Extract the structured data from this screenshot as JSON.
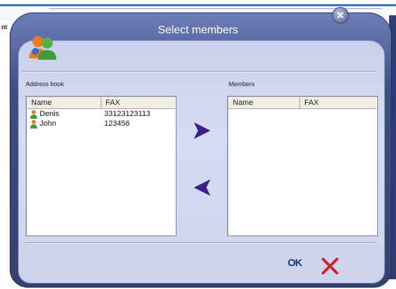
{
  "background": {
    "label": "nt"
  },
  "dialog": {
    "title": "Select members",
    "close_symbol": "✕",
    "address_book": {
      "label": "Address book",
      "columns": [
        "Name",
        "FAX"
      ],
      "rows": [
        {
          "name": "Denis",
          "fax": "33123123113"
        },
        {
          "name": "John",
          "fax": "123456"
        }
      ]
    },
    "members": {
      "label": "Members",
      "columns": [
        "Name",
        "FAX"
      ],
      "rows": []
    },
    "ok_label": "OK"
  },
  "colors": {
    "arrow": "#3f1f8f",
    "cancel": "#d0202a",
    "ok": "#1f3a8a"
  },
  "icons": [
    "group-icon",
    "person-icon",
    "arrow-right-icon",
    "arrow-left-icon",
    "close-icon",
    "cancel-x-icon"
  ]
}
